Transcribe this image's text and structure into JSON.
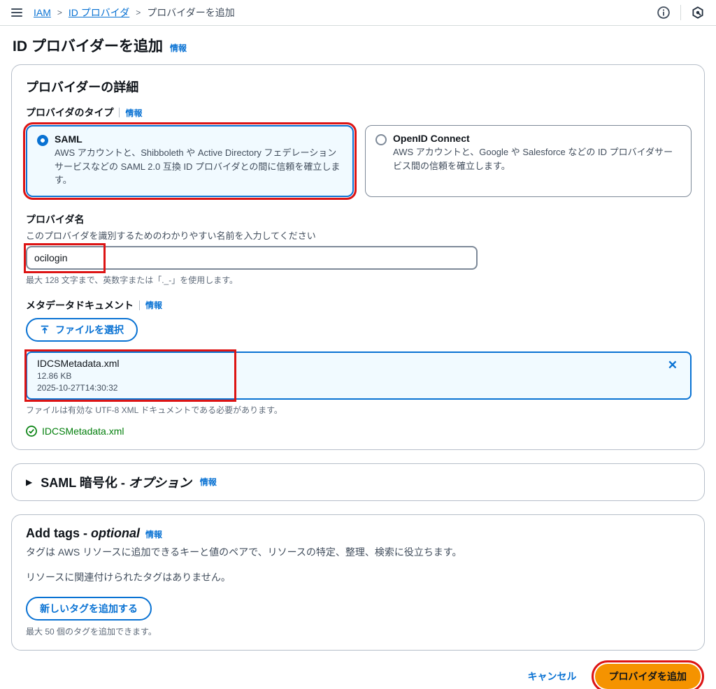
{
  "topbar": {
    "breadcrumb": [
      "IAM",
      "ID プロバイダ",
      "プロバイダーを追加"
    ]
  },
  "page": {
    "title": "ID プロバイダーを追加",
    "info_label": "情報"
  },
  "details": {
    "heading": "プロバイダーの詳細",
    "type_label": "プロバイダのタイプ",
    "info_label": "情報",
    "options": [
      {
        "name": "SAML",
        "description": "AWS アカウントと、Shibboleth や Active Directory フェデレーションサービスなどの SAML 2.0 互換 ID プロバイダとの間に信頼を確立します。"
      },
      {
        "name": "OpenID Connect",
        "description": "AWS アカウントと、Google や Salesforce などの ID プロバイダサービス間の信頼を確立します。"
      }
    ],
    "provider_name": {
      "label": "プロバイダ名",
      "description": "このプロバイダを識別するためのわかりやすい名前を入力してください",
      "value": "ocilogin",
      "hint": "最大 128 文字まで、英数字または「._-」を使用します。"
    },
    "metadata": {
      "label": "メタデータドキュメント",
      "info_label": "情報",
      "choose_file_label": "ファイルを選択",
      "file_name": "IDCSMetadata.xml",
      "file_size": "12.86 KB",
      "file_timestamp": "2025-10-27T14:30:32",
      "close_label": "✕",
      "hint": "ファイルは有効な UTF-8 XML ドキュメントである必要があります。",
      "uploaded_file": "IDCSMetadata.xml"
    }
  },
  "saml_encryption": {
    "heading": "SAML 暗号化 - ",
    "heading_optional": "オプション",
    "info_label": "情報"
  },
  "tags": {
    "heading": "Add tags - ",
    "heading_optional": "optional",
    "info_label": "情報",
    "description": "タグは AWS リソースに追加できるキーと値のペアで、リソースの特定、整理、検索に役立ちます。",
    "empty": "リソースに関連付けられたタグはありません。",
    "add_button": "新しいタグを追加する",
    "hint": "最大 50 個のタグを追加できます。"
  },
  "footer": {
    "cancel": "キャンセル",
    "submit": "プロバイダを追加"
  },
  "colors": {
    "accent": "#0972d3",
    "selected_bg": "#f1faff",
    "primary_button": "#f59300",
    "success": "#037f0c",
    "annotation": "#dd1414"
  }
}
